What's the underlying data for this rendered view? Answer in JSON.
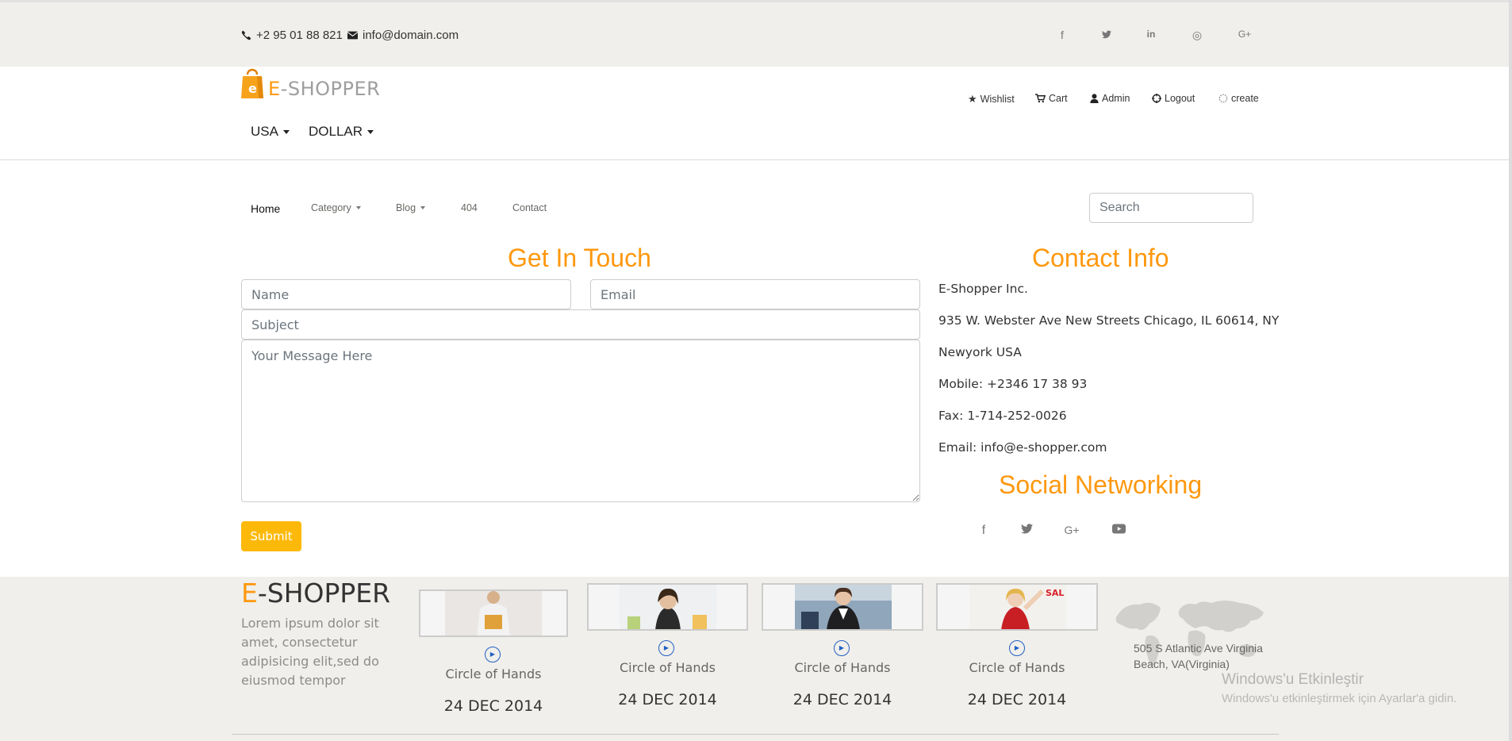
{
  "topbar": {
    "phone": "+2 95 01 88 821",
    "email": "info@domain.com",
    "social": [
      {
        "icon": "facebook-icon",
        "glyph": "f"
      },
      {
        "icon": "twitter-icon",
        "glyph": "🐦"
      },
      {
        "icon": "linkedin-icon",
        "glyph": "in"
      },
      {
        "icon": "dribbble-icon",
        "glyph": "◎"
      },
      {
        "icon": "google-plus-icon",
        "glyph": "G+"
      }
    ]
  },
  "header": {
    "logo_accent": "E",
    "logo_rest": "-SHOPPER",
    "links": {
      "wishlist": "Wishlist",
      "cart": "Cart",
      "admin": "Admin",
      "logout": "Logout",
      "create": "create"
    },
    "country": "USA",
    "currency": "DOLLAR"
  },
  "nav": {
    "home": "Home",
    "category": "Category",
    "blog": "Blog",
    "notfound": "404",
    "contact": "Contact",
    "search_placeholder": "Search"
  },
  "contact_form": {
    "title": "Get In Touch",
    "name_placeholder": "Name",
    "email_placeholder": "Email",
    "subject_placeholder": "Subject",
    "message_placeholder": "Your Message Here",
    "submit_label": "Submit"
  },
  "contact_info": {
    "title": "Contact Info",
    "lines": [
      "E-Shopper Inc.",
      "935 W. Webster Ave New Streets Chicago, IL 60614, NY",
      "Newyork USA",
      "Mobile: +2346 17 38 93",
      "Fax: 1-714-252-0026",
      "Email: info@e-shopper.com"
    ],
    "social_title": "Social Networking"
  },
  "footer": {
    "logo_accent": "E",
    "logo_rest": "-SHOPPER",
    "description": "Lorem ipsum dolor sit amet, consectetur adipisicing elit,sed do eiusmod tempor",
    "videos": [
      {
        "caption": "Circle of Hands",
        "date": "24 DEC 2014"
      },
      {
        "caption": "Circle of Hands",
        "date": "24 DEC 2014"
      },
      {
        "caption": "Circle of Hands",
        "date": "24 DEC 2014"
      },
      {
        "caption": "Circle of Hands",
        "date": "24 DEC 2014"
      }
    ],
    "address": "505 S Atlantic Ave Virginia Beach, VA(Virginia)"
  },
  "watermark": {
    "line1": "Windows'u Etkinleştir",
    "line2": "Windows'u etkinleştirmek için Ayarlar'a gidin."
  },
  "colors": {
    "accent": "#fe980f",
    "submit": "#fdb909",
    "topbar_bg": "#f0efeb"
  }
}
